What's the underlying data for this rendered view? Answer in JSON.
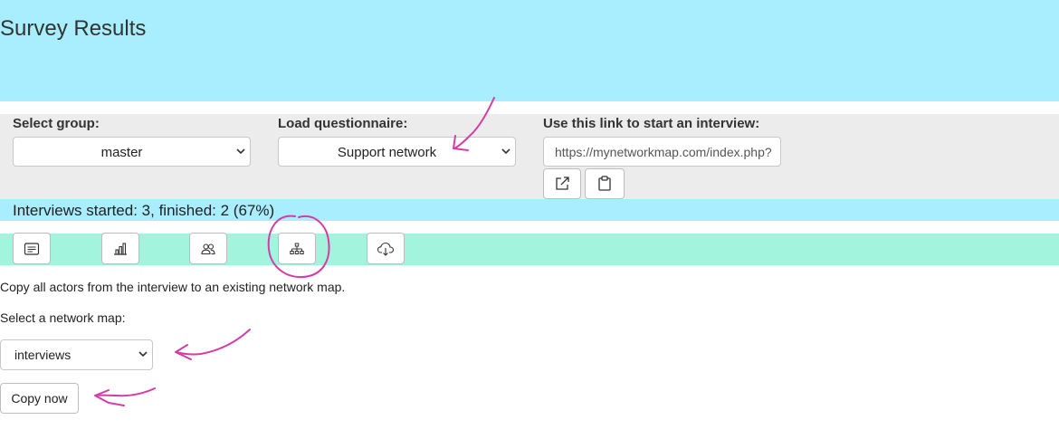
{
  "page": {
    "title": "Survey Results"
  },
  "settings": {
    "group": {
      "label": "Select group:",
      "value": "master"
    },
    "questionnaire": {
      "label": "Load questionnaire:",
      "value": "Support network"
    },
    "link": {
      "label": "Use this link to start an interview:",
      "value": "https://mynetworkmap.com/index.php?"
    },
    "open_link_icon": "external-link-icon",
    "copy_link_icon": "clipboard-icon"
  },
  "status": {
    "text": "Interviews started: 3, finished: 2 (67%)"
  },
  "toolbar": {
    "buttons": [
      {
        "icon": "list-icon"
      },
      {
        "icon": "bar-chart-icon"
      },
      {
        "icon": "people-icon"
      },
      {
        "icon": "network-icon"
      },
      {
        "icon": "cloud-download-icon"
      }
    ]
  },
  "panel": {
    "description": "Copy all actors from the interview to an existing network map.",
    "map_label": "Select a network map:",
    "map_value": "interviews",
    "copy_button": "Copy now"
  },
  "colors": {
    "header_bg": "#a9eefe",
    "toolbar_bg": "#a2f5dc",
    "settings_bg": "#ececec",
    "annotation": "#d63ca6"
  }
}
